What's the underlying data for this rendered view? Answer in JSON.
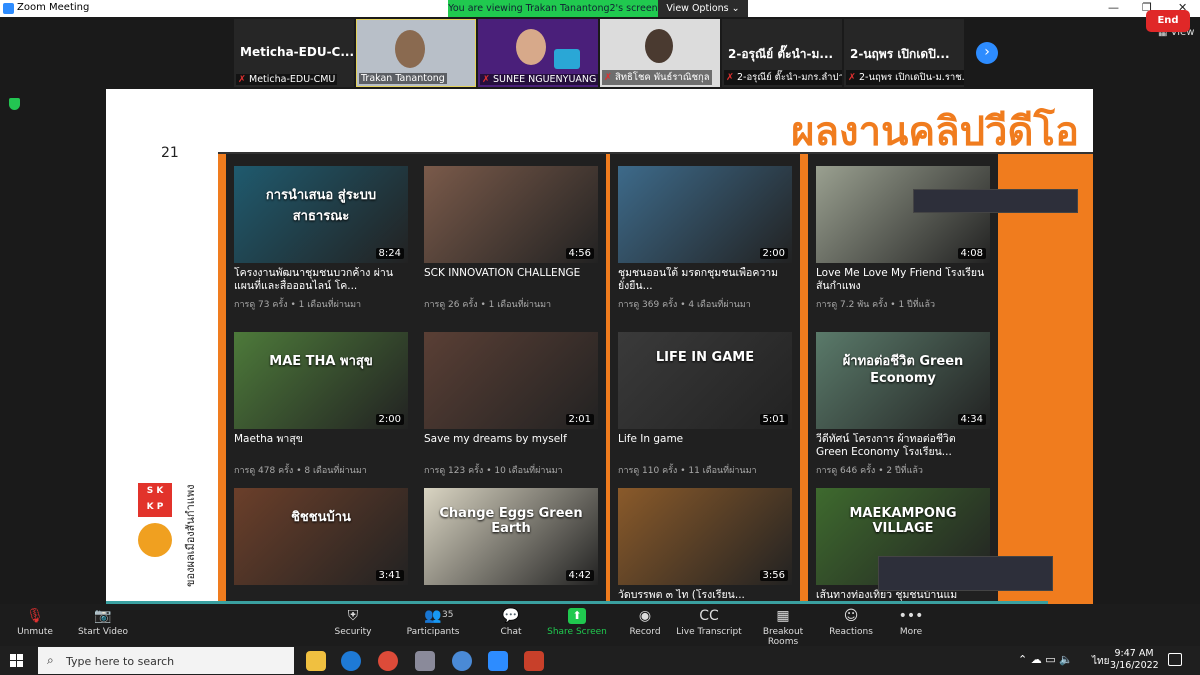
{
  "window": {
    "title": "Zoom Meeting"
  },
  "share_banner": {
    "text": "You are viewing Trakan Tanantong2's screen",
    "view_options": "View Options ⌄"
  },
  "strip": {
    "tiles": [
      {
        "big": "Meticha-EDU-C...",
        "label": "Meticha-EDU-CMU",
        "muted": true
      },
      {
        "big": "",
        "label": "Trakan Tanantong",
        "muted": false
      },
      {
        "big": "",
        "label": "SUNEE NGUENYUANG",
        "muted": true
      },
      {
        "big": "",
        "label": "สิทธิโชค พันธ์ราณิชกุล",
        "muted": true
      },
      {
        "big": "2-อรุณีย์ ตั๊ะนำ-ม...",
        "label": "2-อรุณีย์ ตั๊ะนำ-มกร.ลำปาง",
        "muted": true
      },
      {
        "big": "2-นฤพร เปิกเดปิ...",
        "label": "2-นฤพร เปิกเดปิน-ม.ราช...",
        "muted": true
      }
    ],
    "next_icon": "chevron-right-icon",
    "view_label": "View"
  },
  "slide": {
    "title": "ผลงานคลิปวีดีโอ",
    "number": "21",
    "logo_text": "ของผลเมืองสันกำแพง",
    "columns": [
      [
        {
          "title": "โครงงานพัฒนาชุมชนบวกค้าง ผ่านแผนที่และสื่อออนไลน์ โค...",
          "meta": "การดู 73 ครั้ง • 1 เดือนที่ผ่านมา",
          "duration": "8:24",
          "bg": "#1f5a6e",
          "thumb_text": "การนำเสนอ สู่ระบบสาธารณะ"
        },
        {
          "title": "Maetha พาสุข",
          "meta": "การดู 478 ครั้ง • 8 เดือนที่ผ่านมา",
          "duration": "2:00",
          "bg": "#4d7a3a",
          "thumb_text": "MAE THA พาสุข"
        },
        {
          "title": "",
          "meta": "",
          "duration": "3:41",
          "bg": "#6b3f2a",
          "thumb_text": "ชิชชนบ้าน"
        }
      ],
      [
        {
          "title": "SCK INNOVATION CHALLENGE",
          "meta": "การดู 26 ครั้ง • 1 เดือนที่ผ่านมา",
          "duration": "4:56",
          "bg": "#7a5a4a",
          "thumb_text": ""
        },
        {
          "title": "Save my dreams by myself",
          "meta": "การดู 123 ครั้ง • 10 เดือนที่ผ่านมา",
          "duration": "2:01",
          "bg": "#5a3f35",
          "thumb_text": ""
        },
        {
          "title": "",
          "meta": "",
          "duration": "4:42",
          "bg": "#d9d4c2",
          "thumb_text": "Change Eggs Green Earth"
        }
      ],
      [
        {
          "title": "ชุมชนออนใต้ มรดกชุมชนเพื่อความยั่งยืน...",
          "meta": "การดู 369 ครั้ง • 4 เดือนที่ผ่านมา",
          "duration": "2:00",
          "bg": "#3d6a8a",
          "thumb_text": ""
        },
        {
          "title": "Life In game",
          "meta": "การดู 110 ครั้ง • 11 เดือนที่ผ่านมา",
          "duration": "5:01",
          "bg": "#3a3a3a",
          "thumb_text": "LIFE IN GAME"
        },
        {
          "title": "วัดบรรพต ๓ ไท (โรงเรียน...",
          "meta": "",
          "duration": "3:56",
          "bg": "#8a5a2a",
          "thumb_text": ""
        }
      ],
      [
        {
          "title": "Love Me Love My Friend โรงเรียนสันกำแพง",
          "meta": "การดู 7.2 พัน ครั้ง • 1 ปีที่แล้ว",
          "duration": "4:08",
          "bg": "#9aa090",
          "thumb_text": ""
        },
        {
          "title": "วีดีทัศน์ โครงการ ผ้าทอต่อชีวิต Green Economy โรงเรียน...",
          "meta": "การดู 646 ครั้ง • 2 ปีที่แล้ว",
          "duration": "4:34",
          "bg": "#5a7a6a",
          "thumb_text": "ผ้าทอต่อชีวิต Green Economy"
        },
        {
          "title": "เส้นทางท่องเที่ยว ชุมชนบ้านแม",
          "meta": "",
          "duration": "",
          "bg": "#3e6a2e",
          "thumb_text": "MAEKAMPONG VILLAGE"
        }
      ]
    ]
  },
  "toolbar": {
    "items": [
      {
        "label": "Unmute",
        "icon": "mic-off-icon"
      },
      {
        "label": "Start Video",
        "icon": "video-off-icon"
      },
      {
        "label": "Security",
        "icon": "shield-icon"
      },
      {
        "label": "Participants",
        "icon": "participants-icon",
        "count": "35"
      },
      {
        "label": "Chat",
        "icon": "chat-icon"
      },
      {
        "label": "Share Screen",
        "icon": "share-screen-icon"
      },
      {
        "label": "Record",
        "icon": "record-icon"
      },
      {
        "label": "Live Transcript",
        "icon": "cc-icon"
      },
      {
        "label": "Breakout Rooms",
        "icon": "breakout-icon"
      },
      {
        "label": "Reactions",
        "icon": "reactions-icon"
      },
      {
        "label": "More",
        "icon": "more-icon"
      }
    ],
    "end_label": "End"
  },
  "taskbar": {
    "search_placeholder": "Type here to search",
    "lang": "ไทย",
    "time": "9:47 AM",
    "date": "3/16/2022"
  },
  "colors": {
    "accent": "#f07c1e",
    "zoom_blue": "#2d8cff",
    "share_green": "#20c94f",
    "end_red": "#e02828"
  }
}
